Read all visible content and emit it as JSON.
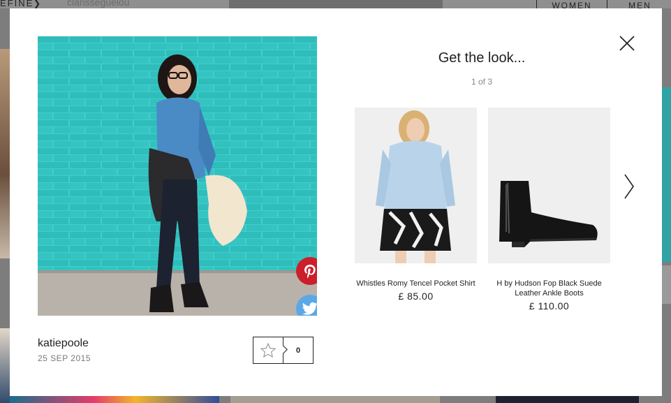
{
  "background": {
    "refine_label": "EFINE",
    "username": "clarisseguelou",
    "tabs": [
      "WOMEN",
      "MEN"
    ]
  },
  "modal": {
    "author": "katiepoole",
    "date": "25 SEP 2015",
    "like_count": "0",
    "panel_title": "Get the look...",
    "pager": "1 of 3",
    "products": [
      {
        "name": "Whistles Romy Tencel Pocket Shirt",
        "price": "£ 85.00"
      },
      {
        "name": "H by Hudson Fop Black Suede Leather Ankle Boots",
        "price": "£ 110.00"
      }
    ],
    "icons": {
      "close": "close-icon",
      "pinterest": "pinterest-icon",
      "twitter": "twitter-icon",
      "star": "star-icon",
      "next": "chevron-right-icon"
    },
    "colors": {
      "pinterest": "#cb1f2c",
      "twitter": "#5aa9e6",
      "wall": "#3cc9c7"
    }
  }
}
